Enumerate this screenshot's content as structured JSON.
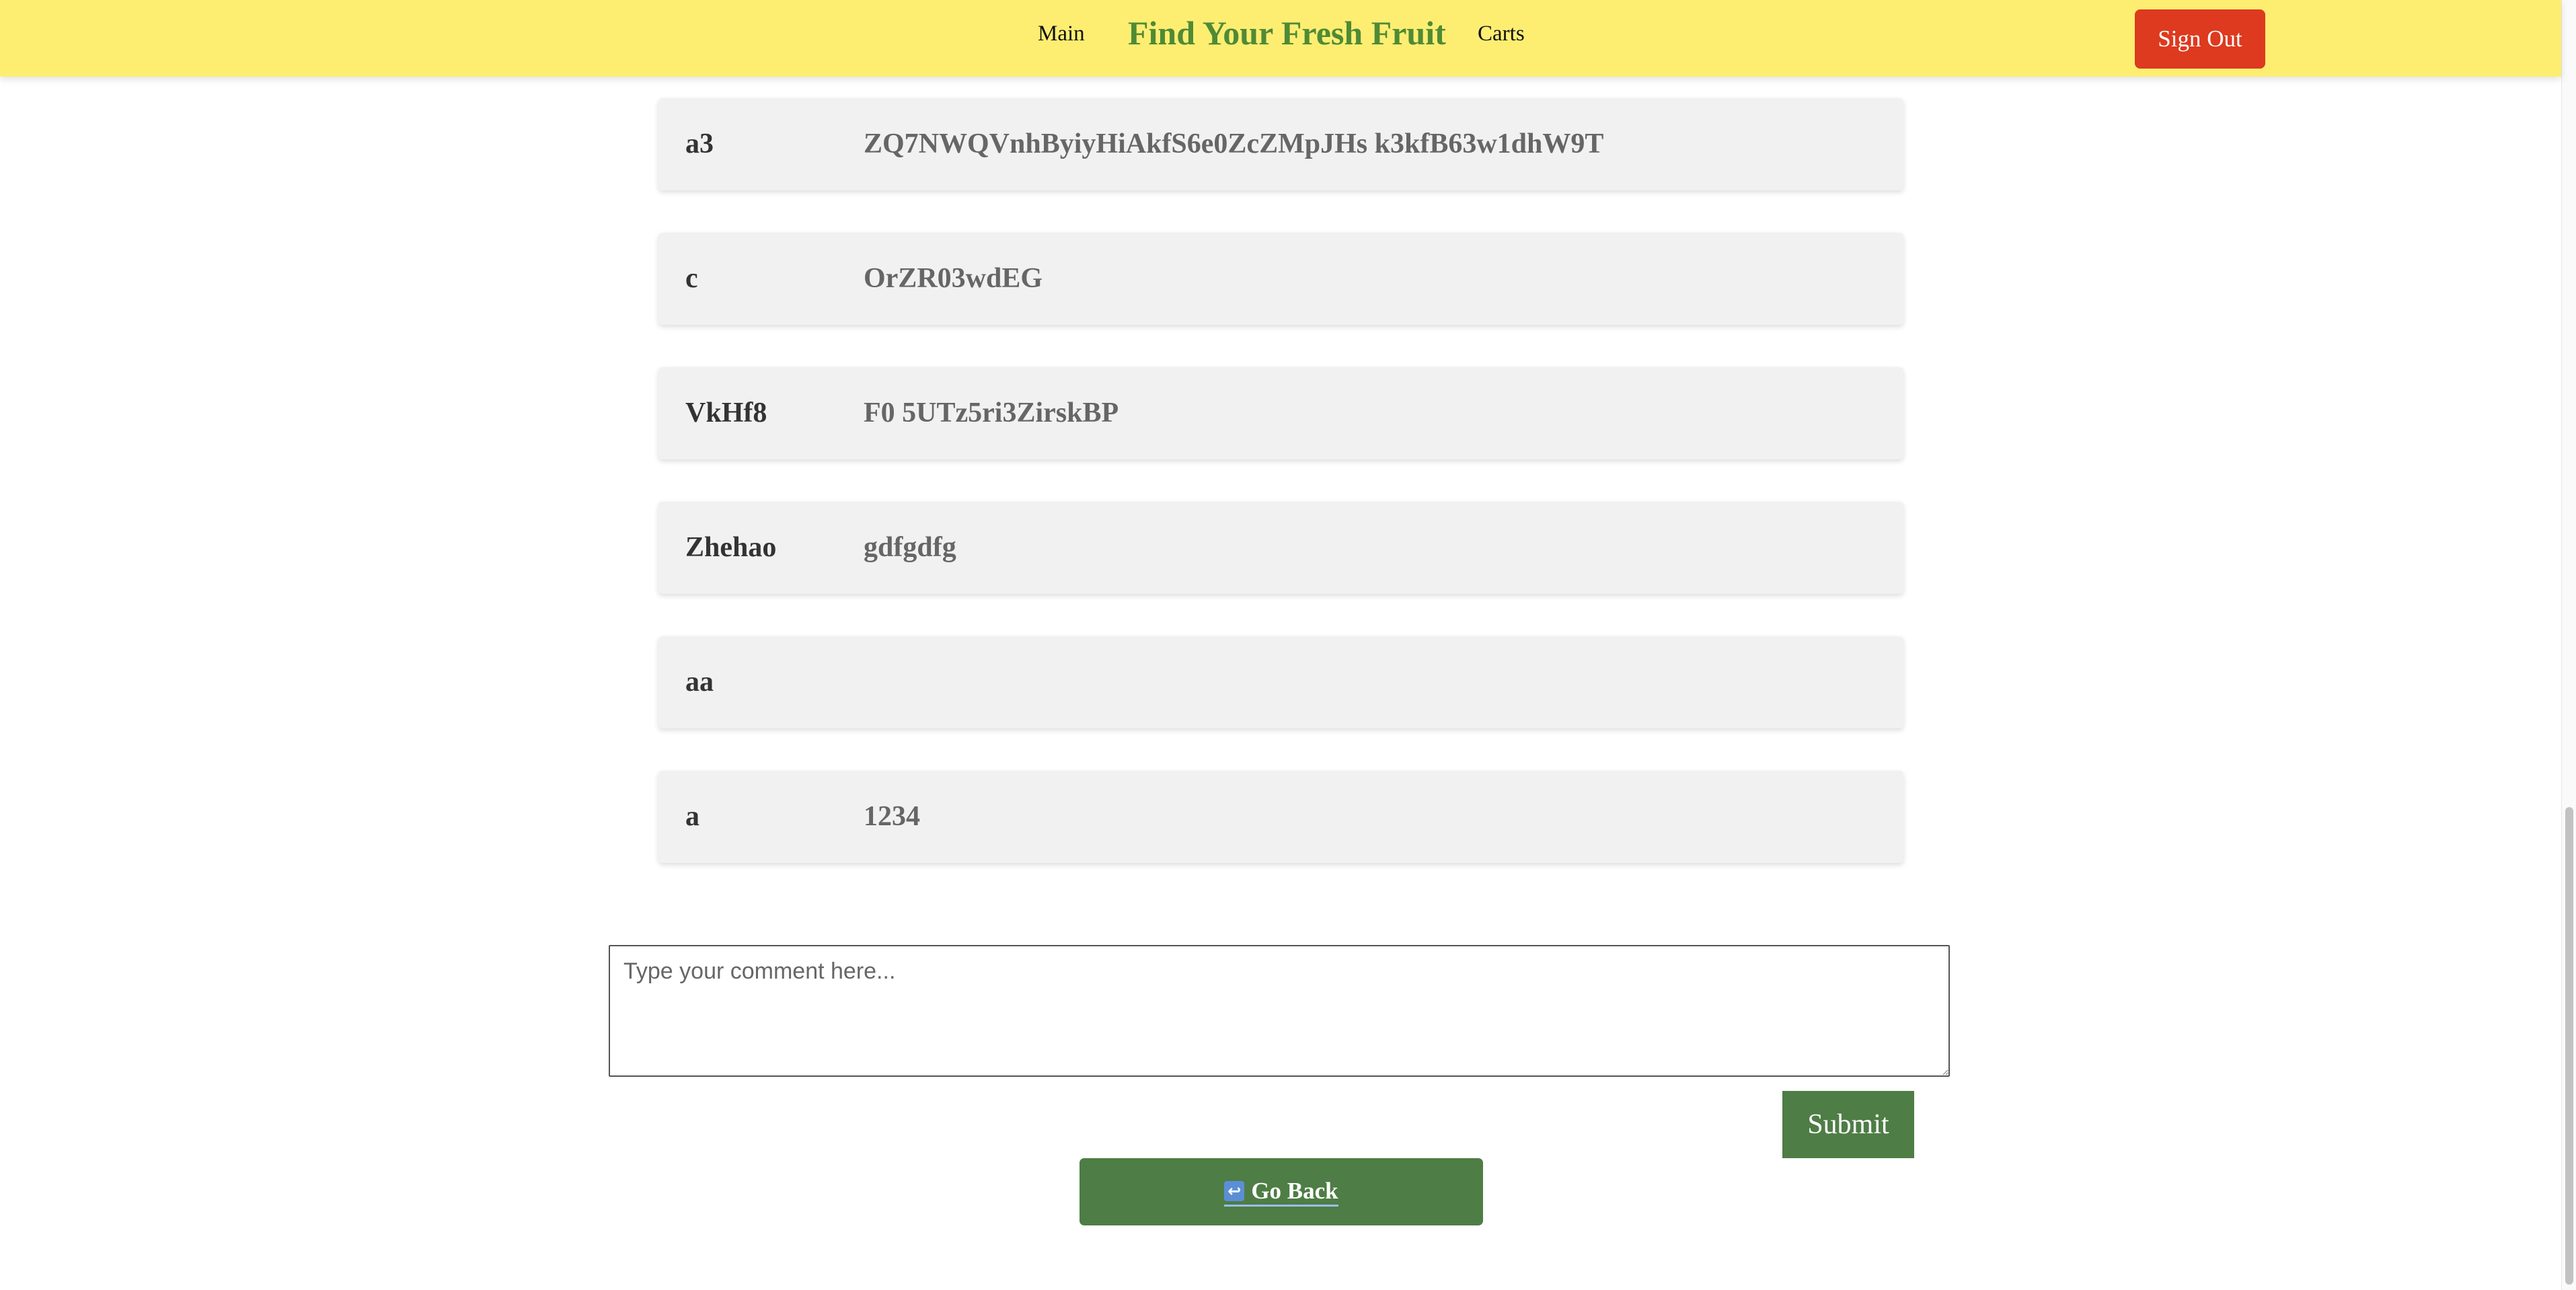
{
  "header": {
    "brand": "Find Your Fresh Fruit",
    "nav_main": "Main",
    "nav_carts": "Carts",
    "sign_out": "Sign Out"
  },
  "comments": [
    {
      "name": "a3",
      "text": "ZQ7NWQVnhByiyHiAkfS6e0ZcZMpJHs k3kfB63w1dhW9T"
    },
    {
      "name": "c",
      "text": "OrZR03wdEG"
    },
    {
      "name": "VkHf8",
      "text": "F0 5UTz5ri3ZirskBP"
    },
    {
      "name": "Zhehao",
      "text": "gdfgdfg"
    },
    {
      "name": "aa",
      "text": ""
    },
    {
      "name": "a",
      "text": "1234"
    }
  ],
  "comment_form": {
    "placeholder": "Type your comment here...",
    "value": "",
    "submit_label": "Submit"
  },
  "go_back": {
    "icon": "return-arrow-icon",
    "label": "Go Back"
  },
  "colors": {
    "header_bg": "#fdee72",
    "brand": "#4f8a35",
    "sign_out": "#dd3a1f",
    "primary_button": "#4e7d45",
    "card_bg": "#f1f1f1"
  }
}
